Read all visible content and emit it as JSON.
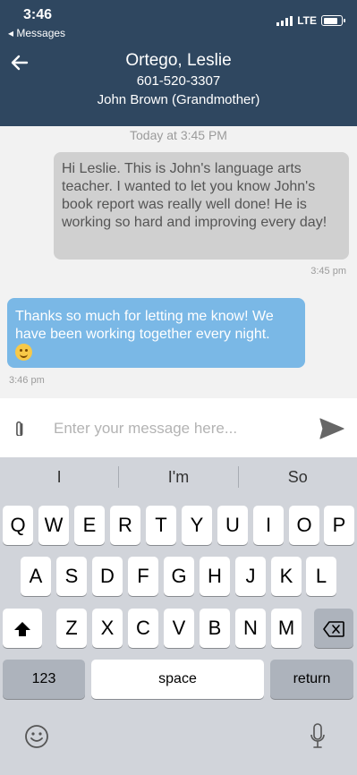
{
  "status": {
    "time": "3:46",
    "back_app": "◂ Messages",
    "network": "LTE"
  },
  "header": {
    "name": "Ortego, Leslie",
    "phone": "601-520-3307",
    "guardian": "John Brown  (Grandmother)"
  },
  "messages": {
    "date_label": "Today at 3:45 PM",
    "outgoing_text": "Hi Leslie. This is John's language arts teacher. I wanted to let you know John's book report was really well done! He is working so hard and improving every day!",
    "outgoing_time": "3:45 pm",
    "incoming_text": "Thanks so much for letting me know! We have been working together every night.",
    "incoming_time": "3:46 pm"
  },
  "compose": {
    "placeholder": "Enter your message here..."
  },
  "keyboard": {
    "suggestions": [
      "I",
      "I'm",
      "So"
    ],
    "row1": [
      "Q",
      "W",
      "E",
      "R",
      "T",
      "Y",
      "U",
      "I",
      "O",
      "P"
    ],
    "row2": [
      "A",
      "S",
      "D",
      "F",
      "G",
      "H",
      "J",
      "K",
      "L"
    ],
    "row3": [
      "Z",
      "X",
      "C",
      "V",
      "B",
      "N",
      "M"
    ],
    "numbers_label": "123",
    "space_label": "space",
    "return_label": "return"
  },
  "colors": {
    "header_bg": "#2f4760",
    "incoming_bubble": "#7ab8e6",
    "outgoing_bubble": "#d0d0d0"
  }
}
